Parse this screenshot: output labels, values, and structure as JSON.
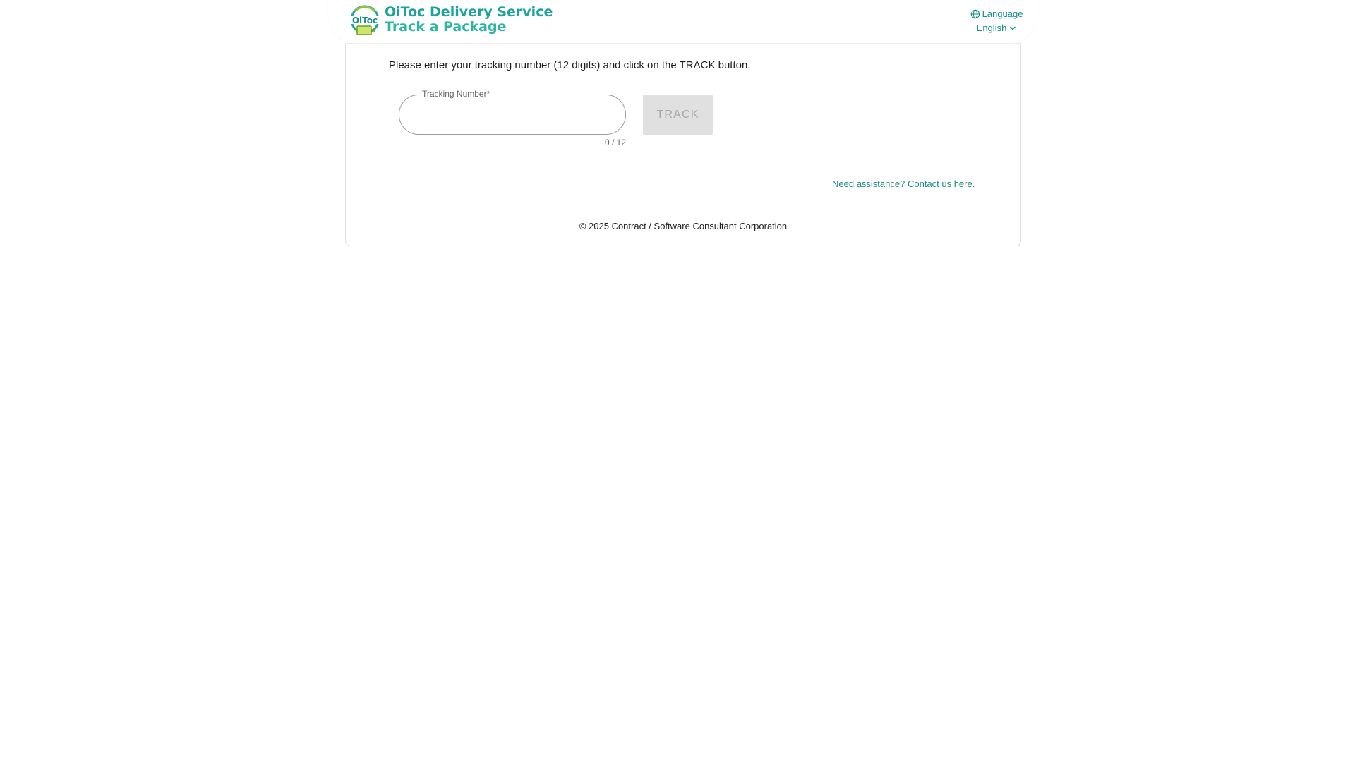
{
  "header": {
    "brand_line1": "OiToc Delivery Service",
    "brand_line2": "Track a Package",
    "logo_icon": "oitoc-logo-icon",
    "language_label": "Language",
    "language_value": "English",
    "globe_icon": "globe-icon",
    "chevron_icon": "chevron-down-icon"
  },
  "main": {
    "instruction": "Please enter your tracking number (12 digits) and click on the TRACK button.",
    "tracking_field": {
      "label": "Tracking Number*",
      "value": "",
      "counter": "0 / 12"
    },
    "track_button": "TRACK",
    "help_link": "Need assistance? Contact us here."
  },
  "footer": {
    "copyright": "© 2025 Contract / Software Consultant Corporation"
  },
  "colors": {
    "brand": "#1ba39c",
    "link": "#1a8a85",
    "button_disabled_bg": "#e0e0e0",
    "button_disabled_text": "#a6a6a6",
    "divider": "#8fc9c6"
  }
}
